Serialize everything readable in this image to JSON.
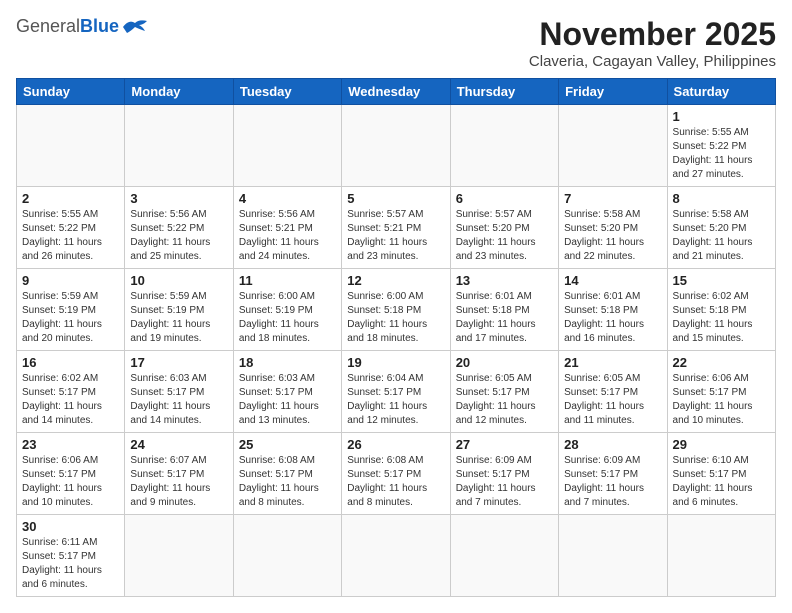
{
  "header": {
    "logo_general": "General",
    "logo_blue": "Blue",
    "month_title": "November 2025",
    "subtitle": "Claveria, Cagayan Valley, Philippines"
  },
  "weekdays": [
    "Sunday",
    "Monday",
    "Tuesday",
    "Wednesday",
    "Thursday",
    "Friday",
    "Saturday"
  ],
  "days": {
    "d1": {
      "num": "1",
      "sunrise": "5:55 AM",
      "sunset": "5:22 PM",
      "daylight": "11 hours and 27 minutes."
    },
    "d2": {
      "num": "2",
      "sunrise": "5:55 AM",
      "sunset": "5:22 PM",
      "daylight": "11 hours and 26 minutes."
    },
    "d3": {
      "num": "3",
      "sunrise": "5:56 AM",
      "sunset": "5:22 PM",
      "daylight": "11 hours and 25 minutes."
    },
    "d4": {
      "num": "4",
      "sunrise": "5:56 AM",
      "sunset": "5:21 PM",
      "daylight": "11 hours and 24 minutes."
    },
    "d5": {
      "num": "5",
      "sunrise": "5:57 AM",
      "sunset": "5:21 PM",
      "daylight": "11 hours and 23 minutes."
    },
    "d6": {
      "num": "6",
      "sunrise": "5:57 AM",
      "sunset": "5:20 PM",
      "daylight": "11 hours and 23 minutes."
    },
    "d7": {
      "num": "7",
      "sunrise": "5:58 AM",
      "sunset": "5:20 PM",
      "daylight": "11 hours and 22 minutes."
    },
    "d8": {
      "num": "8",
      "sunrise": "5:58 AM",
      "sunset": "5:20 PM",
      "daylight": "11 hours and 21 minutes."
    },
    "d9": {
      "num": "9",
      "sunrise": "5:59 AM",
      "sunset": "5:19 PM",
      "daylight": "11 hours and 20 minutes."
    },
    "d10": {
      "num": "10",
      "sunrise": "5:59 AM",
      "sunset": "5:19 PM",
      "daylight": "11 hours and 19 minutes."
    },
    "d11": {
      "num": "11",
      "sunrise": "6:00 AM",
      "sunset": "5:19 PM",
      "daylight": "11 hours and 18 minutes."
    },
    "d12": {
      "num": "12",
      "sunrise": "6:00 AM",
      "sunset": "5:18 PM",
      "daylight": "11 hours and 18 minutes."
    },
    "d13": {
      "num": "13",
      "sunrise": "6:01 AM",
      "sunset": "5:18 PM",
      "daylight": "11 hours and 17 minutes."
    },
    "d14": {
      "num": "14",
      "sunrise": "6:01 AM",
      "sunset": "5:18 PM",
      "daylight": "11 hours and 16 minutes."
    },
    "d15": {
      "num": "15",
      "sunrise": "6:02 AM",
      "sunset": "5:18 PM",
      "daylight": "11 hours and 15 minutes."
    },
    "d16": {
      "num": "16",
      "sunrise": "6:02 AM",
      "sunset": "5:17 PM",
      "daylight": "11 hours and 14 minutes."
    },
    "d17": {
      "num": "17",
      "sunrise": "6:03 AM",
      "sunset": "5:17 PM",
      "daylight": "11 hours and 14 minutes."
    },
    "d18": {
      "num": "18",
      "sunrise": "6:03 AM",
      "sunset": "5:17 PM",
      "daylight": "11 hours and 13 minutes."
    },
    "d19": {
      "num": "19",
      "sunrise": "6:04 AM",
      "sunset": "5:17 PM",
      "daylight": "11 hours and 12 minutes."
    },
    "d20": {
      "num": "20",
      "sunrise": "6:05 AM",
      "sunset": "5:17 PM",
      "daylight": "11 hours and 12 minutes."
    },
    "d21": {
      "num": "21",
      "sunrise": "6:05 AM",
      "sunset": "5:17 PM",
      "daylight": "11 hours and 11 minutes."
    },
    "d22": {
      "num": "22",
      "sunrise": "6:06 AM",
      "sunset": "5:17 PM",
      "daylight": "11 hours and 10 minutes."
    },
    "d23": {
      "num": "23",
      "sunrise": "6:06 AM",
      "sunset": "5:17 PM",
      "daylight": "11 hours and 10 minutes."
    },
    "d24": {
      "num": "24",
      "sunrise": "6:07 AM",
      "sunset": "5:17 PM",
      "daylight": "11 hours and 9 minutes."
    },
    "d25": {
      "num": "25",
      "sunrise": "6:08 AM",
      "sunset": "5:17 PM",
      "daylight": "11 hours and 8 minutes."
    },
    "d26": {
      "num": "26",
      "sunrise": "6:08 AM",
      "sunset": "5:17 PM",
      "daylight": "11 hours and 8 minutes."
    },
    "d27": {
      "num": "27",
      "sunrise": "6:09 AM",
      "sunset": "5:17 PM",
      "daylight": "11 hours and 7 minutes."
    },
    "d28": {
      "num": "28",
      "sunrise": "6:09 AM",
      "sunset": "5:17 PM",
      "daylight": "11 hours and 7 minutes."
    },
    "d29": {
      "num": "29",
      "sunrise": "6:10 AM",
      "sunset": "5:17 PM",
      "daylight": "11 hours and 6 minutes."
    },
    "d30": {
      "num": "30",
      "sunrise": "6:11 AM",
      "sunset": "5:17 PM",
      "daylight": "11 hours and 6 minutes."
    }
  }
}
